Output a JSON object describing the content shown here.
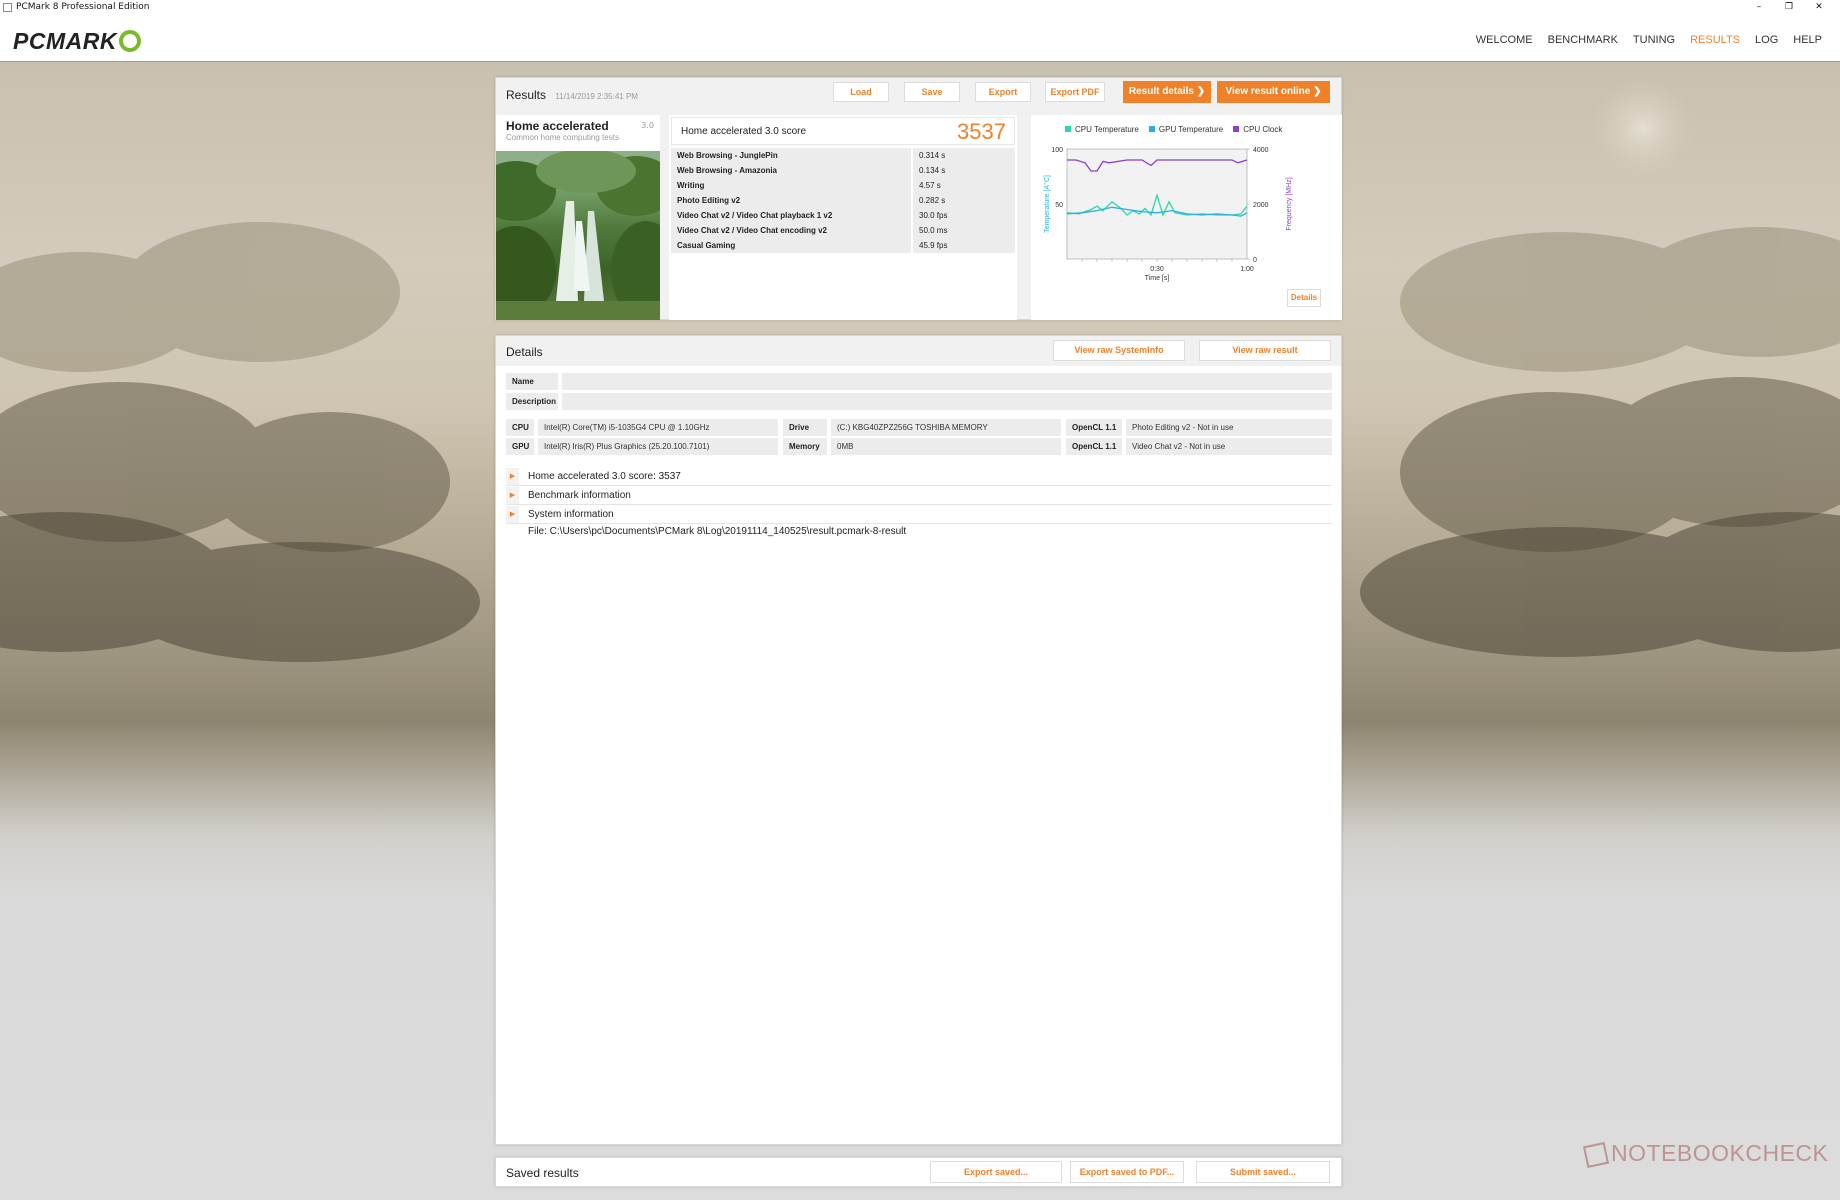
{
  "window": {
    "title": "PCMark 8 Professional Edition"
  },
  "brand": {
    "logo_text": "PCMARK",
    "accent": "#f0812b",
    "logo_green": "#7ab929"
  },
  "nav": {
    "items": [
      {
        "label": "WELCOME",
        "active": false
      },
      {
        "label": "BENCHMARK",
        "active": false
      },
      {
        "label": "TUNING",
        "active": false
      },
      {
        "label": "RESULTS",
        "active": true
      },
      {
        "label": "LOG",
        "active": false
      },
      {
        "label": "HELP",
        "active": false
      }
    ]
  },
  "results": {
    "title": "Results",
    "timestamp": "11/14/2019 2:35:41 PM",
    "buttons": {
      "load": "Load",
      "save": "Save",
      "export": "Export",
      "export_pdf": "Export PDF",
      "result_details": "Result details",
      "view_online": "View result online"
    },
    "benchmark": {
      "name": "Home accelerated",
      "version": "3.0",
      "subtitle": "Common home computing tests"
    },
    "score_label": "Home accelerated 3.0 score",
    "score": "3537",
    "rows": [
      {
        "name": "Web Browsing - JunglePin",
        "value": "0.314 s"
      },
      {
        "name": "Web Browsing - Amazonia",
        "value": "0.134 s"
      },
      {
        "name": "Writing",
        "value": "4.57 s"
      },
      {
        "name": "Photo Editing v2",
        "value": "0.282 s"
      },
      {
        "name": "Video Chat v2 / Video Chat playback 1 v2",
        "value": "30.0 fps"
      },
      {
        "name": "Video Chat v2 / Video Chat encoding v2",
        "value": "50.0 ms"
      },
      {
        "name": "Casual Gaming",
        "value": "45.9 fps"
      }
    ],
    "chart_details_button": "Details"
  },
  "chart_data": {
    "type": "line",
    "legend": [
      "CPU Temperature",
      "GPU Temperature",
      "CPU Clock"
    ],
    "colors": {
      "cpu_temp": "#2bd6b0",
      "gpu_temp": "#2ab0e0",
      "cpu_clock": "#8a3fcf"
    },
    "left_axis": {
      "label": "Temperature [A°C]",
      "ticks": [
        "100",
        "50"
      ],
      "ylim": [
        0,
        100
      ]
    },
    "right_axis": {
      "label": "Frequency [MHz]",
      "ticks": [
        "4000",
        "2000",
        "0"
      ],
      "ylim": [
        0,
        4000
      ]
    },
    "x_axis": {
      "label": "Time [s]",
      "ticks": [
        "0:30",
        "1:00"
      ],
      "xlim": [
        0,
        60
      ]
    },
    "series": [
      {
        "key": "cpu_clock",
        "axis": "right",
        "x": [
          0,
          3,
          6,
          8,
          10,
          12,
          14,
          20,
          25,
          28,
          30,
          40,
          45,
          55,
          57,
          60
        ],
        "y": [
          3600,
          3600,
          3500,
          3200,
          3200,
          3550,
          3500,
          3600,
          3600,
          3400,
          3600,
          3600,
          3600,
          3600,
          3500,
          3600
        ]
      },
      {
        "key": "cpu_temp",
        "axis": "left",
        "x": [
          0,
          4,
          8,
          10,
          12,
          15,
          18,
          20,
          22,
          24,
          26,
          28,
          30,
          32,
          34,
          36,
          40,
          45,
          50,
          55,
          58,
          60
        ],
        "y": [
          42,
          41,
          45,
          48,
          44,
          52,
          46,
          40,
          44,
          41,
          46,
          40,
          58,
          40,
          52,
          42,
          40,
          41,
          40,
          40,
          41,
          48
        ]
      },
      {
        "key": "gpu_temp",
        "axis": "left",
        "x": [
          0,
          5,
          10,
          15,
          20,
          25,
          30,
          35,
          40,
          45,
          50,
          55,
          58,
          60
        ],
        "y": [
          41,
          42,
          44,
          47,
          45,
          43,
          42,
          44,
          41,
          40,
          41,
          40,
          39,
          42
        ]
      }
    ]
  },
  "details": {
    "title": "Details",
    "view_sysinfo": "View raw SystemInfo",
    "view_raw_result": "View raw result",
    "name_label": "Name",
    "description_label": "Description",
    "specs": [
      {
        "label": "CPU",
        "value": "Intel(R) Core(TM) i5-1035G4 CPU @ 1.10GHz"
      },
      {
        "label": "GPU",
        "value": "Intel(R) Iris(R) Plus Graphics (25.20.100.7101)"
      },
      {
        "label": "Drive",
        "value": "(C:) KBG40ZPZ256G TOSHIBA MEMORY"
      },
      {
        "label": "Memory",
        "value": "0MB"
      },
      {
        "label": "OpenCL 1.1",
        "value": "Photo Editing v2 - Not in use"
      },
      {
        "label": "OpenCL 1.1",
        "value": "Video Chat v2 - Not in use"
      }
    ],
    "sections": [
      {
        "label": "Home accelerated 3.0 score: 3537"
      },
      {
        "label": "Benchmark information"
      },
      {
        "label": "System information"
      }
    ],
    "file_path": "File: C:\\Users\\pc\\Documents\\PCMark 8\\Log\\20191114_140525\\result.pcmark-8-result"
  },
  "saved": {
    "title": "Saved results",
    "export_saved": "Export saved...",
    "export_saved_pdf": "Export saved to PDF...",
    "submit_saved": "Submit saved..."
  },
  "watermark": "NOTEBOOKCHECK"
}
